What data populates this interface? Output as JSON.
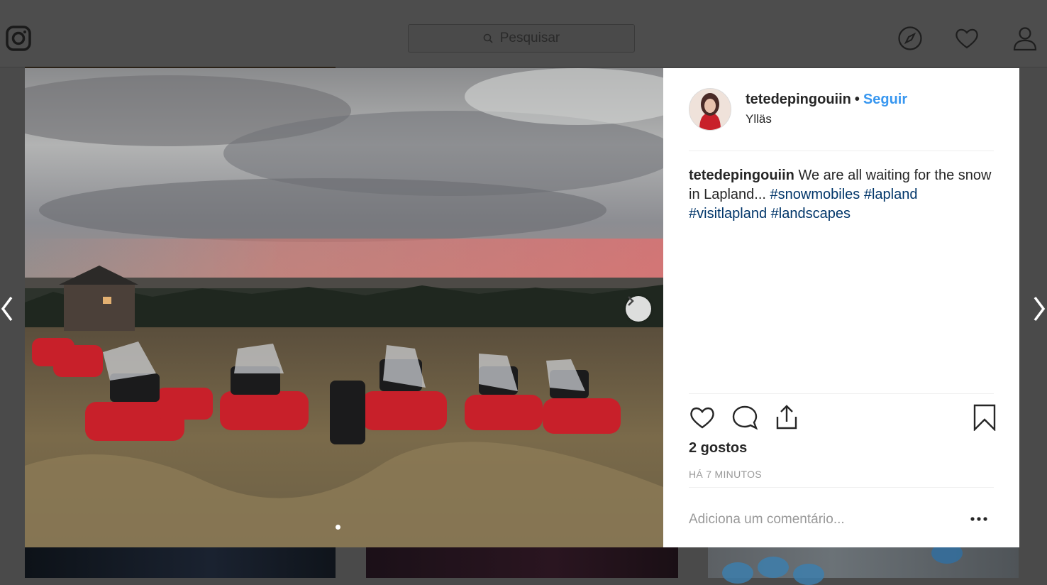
{
  "topbar": {
    "search_placeholder": "Pesquisar",
    "icons": [
      "instagram-logo-icon",
      "search-icon",
      "compass-icon",
      "heart-icon",
      "user-icon"
    ]
  },
  "post": {
    "username": "tetedepingouiin",
    "separator": "•",
    "follow_label": "Seguir",
    "location": "Ylläs",
    "caption": {
      "username": "tetedepingouiin",
      "text": "We are all waiting for the snow in Lapland...",
      "hashtags": [
        "#snowmobiles",
        "#lapland",
        "#visitlapland",
        "#landscapes"
      ]
    },
    "likes": "2 gostos",
    "timestamp": "HÁ 7 MINUTOS",
    "comment_placeholder": "Adiciona um comentário...",
    "more_label": "•••",
    "carousel": {
      "current": 1,
      "total": 1
    }
  },
  "colors": {
    "link_blue": "#3897f0",
    "hashtag_blue": "#003569",
    "overlay": "#4a4a4a",
    "snowmobile_red": "#c8202a"
  }
}
